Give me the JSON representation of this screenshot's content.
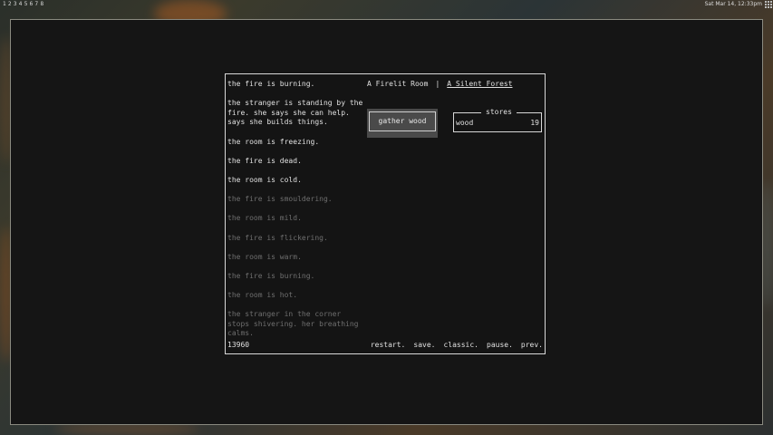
{
  "topbar": {
    "workspaces": [
      "1",
      "2",
      "3",
      "4",
      "5",
      "6",
      "7",
      "8"
    ],
    "clock": "Sat Mar 14, 12:33pm"
  },
  "game": {
    "notifications": [
      {
        "text": "the fire is burning.",
        "faded": false
      },
      {
        "text": "the stranger is standing by the fire. she says she can help. says she builds things.",
        "faded": false
      },
      {
        "text": "the room is freezing.",
        "faded": false
      },
      {
        "text": "the fire is dead.",
        "faded": false
      },
      {
        "text": "the room is cold.",
        "faded": false
      },
      {
        "text": "the fire is smouldering.",
        "faded": true
      },
      {
        "text": "the room is mild.",
        "faded": true
      },
      {
        "text": "the fire is flickering.",
        "faded": true
      },
      {
        "text": "the room is warm.",
        "faded": true
      },
      {
        "text": "the fire is burning.",
        "faded": true
      },
      {
        "text": "the room is hot.",
        "faded": true
      },
      {
        "text": "the stranger in the corner stops shivering. her breathing calms.",
        "faded": true
      }
    ],
    "locations": {
      "current": "A Firelit Room",
      "separator": "|",
      "other": "A Silent Forest"
    },
    "gather_button": "gather wood",
    "stores": {
      "title": "stores",
      "items": [
        {
          "name": "wood",
          "value": "19"
        }
      ]
    },
    "score": "13960",
    "menu": [
      "restart.",
      "save.",
      "classic.",
      "pause.",
      "prev."
    ]
  }
}
